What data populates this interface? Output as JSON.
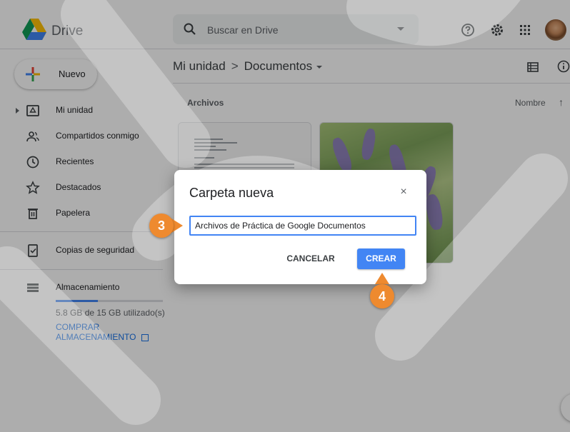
{
  "header": {
    "app_title": "Drive",
    "search_placeholder": "Buscar en Drive",
    "icons": [
      "help-icon",
      "settings-icon",
      "apps-grid-icon"
    ]
  },
  "sidebar": {
    "new_label": "Nuevo",
    "items": [
      {
        "label": "Mi unidad",
        "icon": "my-drive-icon"
      },
      {
        "label": "Compartidos conmigo",
        "icon": "shared-icon"
      },
      {
        "label": "Recientes",
        "icon": "clock-icon"
      },
      {
        "label": "Destacados",
        "icon": "star-icon"
      },
      {
        "label": "Papelera",
        "icon": "trash-icon"
      },
      {
        "label": "Copias de seguridad",
        "icon": "backup-icon"
      },
      {
        "label": "Almacenamiento",
        "icon": "storage-icon"
      }
    ],
    "storage_used_text": "5.8 GB de 15 GB utilizado(s)",
    "storage_used_fraction": 0.39,
    "buy_storage_label": "COMPRAR ALMACENAMIENTO"
  },
  "main": {
    "breadcrumb_root": "Mi unidad",
    "breadcrumb_sep": ">",
    "breadcrumb_current": "Documentos",
    "section_label": "Archivos",
    "sort_label": "Nombre",
    "sort_arrow": "↑"
  },
  "dialog": {
    "title": "Carpeta nueva",
    "close_symbol": "×",
    "folder_name_value": "Archivos de Práctica de Google Documentos",
    "cancel_label": "CANCELAR",
    "create_label": "CREAR"
  },
  "callouts": {
    "step_input": "3",
    "step_create": "4"
  },
  "colors": {
    "accent": "#4285f4",
    "callout": "#ee8a2f",
    "link": "#1a73e8"
  }
}
